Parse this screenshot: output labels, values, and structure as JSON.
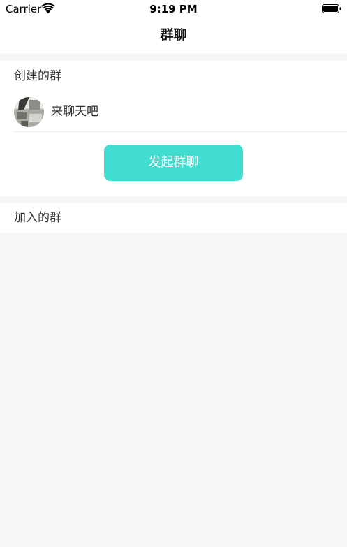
{
  "status_bar": {
    "carrier": "Carrier",
    "time": "9:19 PM",
    "wifi_icon": "wifi-icon",
    "battery_icon": "battery-icon"
  },
  "nav": {
    "title": "群聊"
  },
  "created_section": {
    "header": "创建的群",
    "groups": [
      {
        "name": "来聊天吧",
        "avatar_icon": "group-avatar-photo"
      }
    ],
    "start_button_label": "发起群聊"
  },
  "joined_section": {
    "header": "加入的群"
  },
  "colors": {
    "accent": "#40ddd0",
    "background": "#f7f7f7",
    "surface": "#ffffff"
  }
}
